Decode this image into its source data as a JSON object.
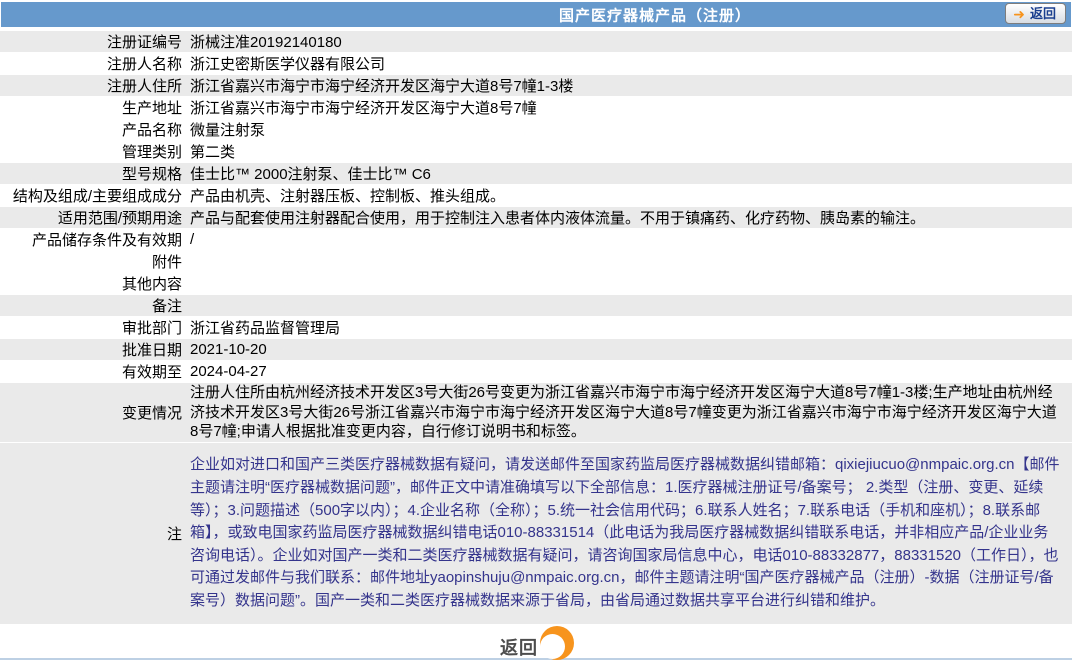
{
  "header": {
    "title": "国产医疗器械产品（注册）",
    "back_button_label": "返回"
  },
  "icons": {
    "back_arrow": "➜"
  },
  "rows": [
    {
      "label": "注册证编号",
      "value": "浙械注准20192140180"
    },
    {
      "label": "注册人名称",
      "value": "浙江史密斯医学仪器有限公司"
    },
    {
      "label": "注册人住所",
      "value": "浙江省嘉兴市海宁市海宁经济开发区海宁大道8号7幢1-3楼"
    },
    {
      "label": "生产地址",
      "value": "浙江省嘉兴市海宁市海宁经济开发区海宁大道8号7幢"
    },
    {
      "label": "产品名称",
      "value": "微量注射泵"
    },
    {
      "label": "管理类别",
      "value": "第二类"
    },
    {
      "label": "型号规格",
      "value": "佳士比™ 2000注射泵、佳士比™ C6"
    },
    {
      "label": "结构及组成/主要组成成分",
      "value": "产品由机壳、注射器压板、控制板、推头组成。"
    },
    {
      "label": "适用范围/预期用途",
      "value": "产品与配套使用注射器配合使用，用于控制注入患者体内液体流量。不用于镇痛药、化疗药物、胰岛素的输注。"
    },
    {
      "label": "产品储存条件及有效期",
      "value": "/"
    },
    {
      "label": "附件",
      "value": ""
    },
    {
      "label": "其他内容",
      "value": ""
    },
    {
      "label": "备注",
      "value": ""
    },
    {
      "label": "审批部门",
      "value": "浙江省药品监督管理局"
    },
    {
      "label": "批准日期",
      "value": "2021-10-20"
    },
    {
      "label": "有效期至",
      "value": "2024-04-27"
    },
    {
      "label": "变更情况",
      "value": "注册人住所由杭州经济技术开发区3号大街26号变更为浙江省嘉兴市海宁市海宁经济开发区海宁大道8号7幢1-3楼;生产地址由杭州经济技术开发区3号大街26号浙江省嘉兴市海宁市海宁经济开发区海宁大道8号7幢变更为浙江省嘉兴市海宁市海宁经济开发区海宁大道8号7幢;申请人根据批准变更内容，自行修订说明书和标签。"
    },
    {
      "label": "注",
      "value": "企业如对进口和国产三类医疗器械数据有疑问，请发送邮件至国家药监局医疗器械数据纠错邮箱：qixiejiucuo@nmpaic.org.cn【邮件主题请注明“医疗器械数据问题”，邮件正文中请准确填写以下全部信息：1.医疗器械注册证号/备案号； 2.类型（注册、变更、延续等）；3.问题描述（500字以内）；4.企业名称（全称）；5.统一社会信用代码；6.联系人姓名；7.联系电话（手机和座机）；8.联系邮箱】，或致电国家药监局医疗器械数据纠错电话010-88331514（此电话为我局医疗器械数据纠错联系电话，并非相应产品/企业业务咨询电话）。企业如对国产一类和二类医疗器械数据有疑问，请咨询国家局信息中心，电话010-88332877，88331520（工作日），也可通过发邮件与我们联系：邮件地址yaopinshuju@nmpaic.org.cn，邮件主题请注明“国产医疗器械产品（注册）-数据（注册证号/备案号）数据问题”。国产一类和二类医疗器械数据来源于省局，由省局通过数据共享平台进行纠错和维护。"
    }
  ],
  "footer": {
    "back_button_label": "返回"
  },
  "colors": {
    "header_bg": "#6699CC",
    "row_shaded_bg": "#EAEAEA",
    "note_text": "#34348C",
    "accent_orange": "#F7941D",
    "back_label_blue": "#1B3F8F"
  }
}
